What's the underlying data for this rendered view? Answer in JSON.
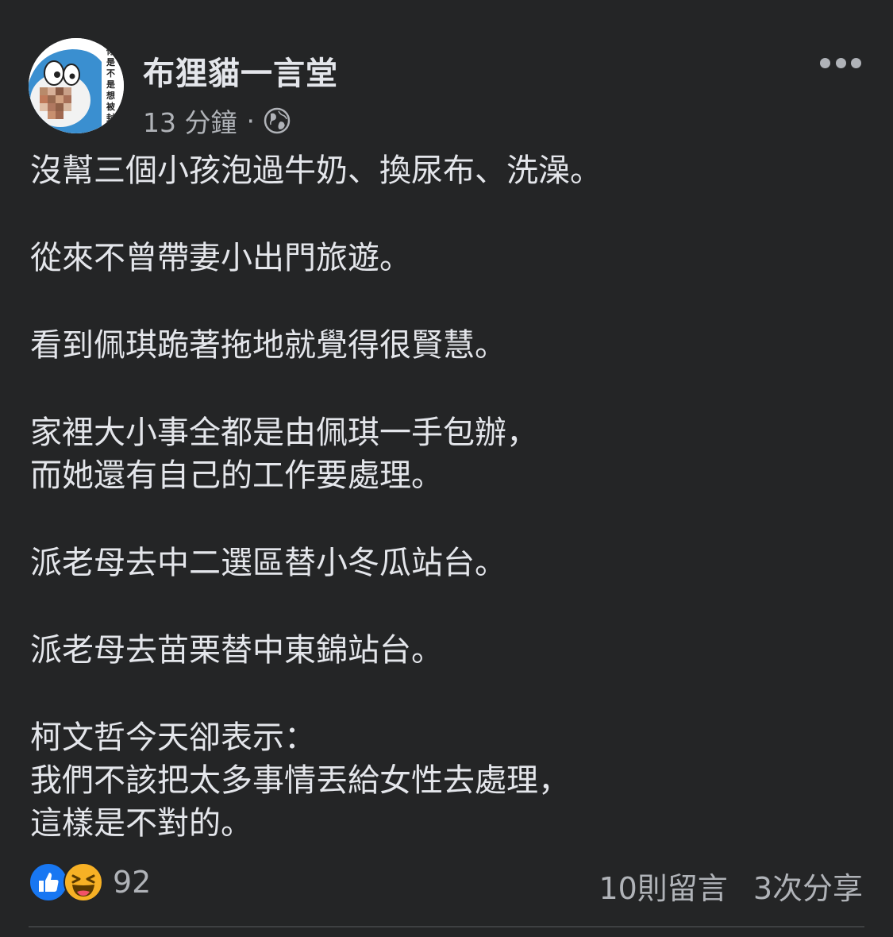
{
  "post": {
    "author": "布狸貓一言堂",
    "avatar_caption": "你是不是想被封鎖",
    "time": "13 分鐘",
    "separator": "·",
    "privacy_icon": "globe-icon",
    "more_icon": "more-options-icon",
    "paragraphs": [
      [
        "沒幫三個小孩泡過牛奶、換尿布、洗澡。"
      ],
      [
        "從來不曾帶妻小出門旅遊。"
      ],
      [
        "看到佩琪跪著拖地就覺得很賢慧。"
      ],
      [
        "家裡大小事全都是由佩琪一手包辦，",
        "而她還有自己的工作要處理。"
      ],
      [
        "派老母去中二選區替小冬瓜站台。"
      ],
      [
        "派老母去苗栗替中東錦站台。"
      ],
      [
        "柯文哲今天卻表示：",
        "我們不該把太多事情丟給女性去處理，",
        "這樣是不對的。"
      ]
    ]
  },
  "footer": {
    "reaction_icons": [
      "like-icon",
      "haha-icon"
    ],
    "reaction_count": "92",
    "comments": "10則留言",
    "shares": "3次分享"
  },
  "colors": {
    "background": "#242526",
    "text_primary": "#e4e6eb",
    "text_secondary": "#b0b3b8",
    "like_blue": "#1877f2",
    "haha_yellow": "#f7b125"
  }
}
